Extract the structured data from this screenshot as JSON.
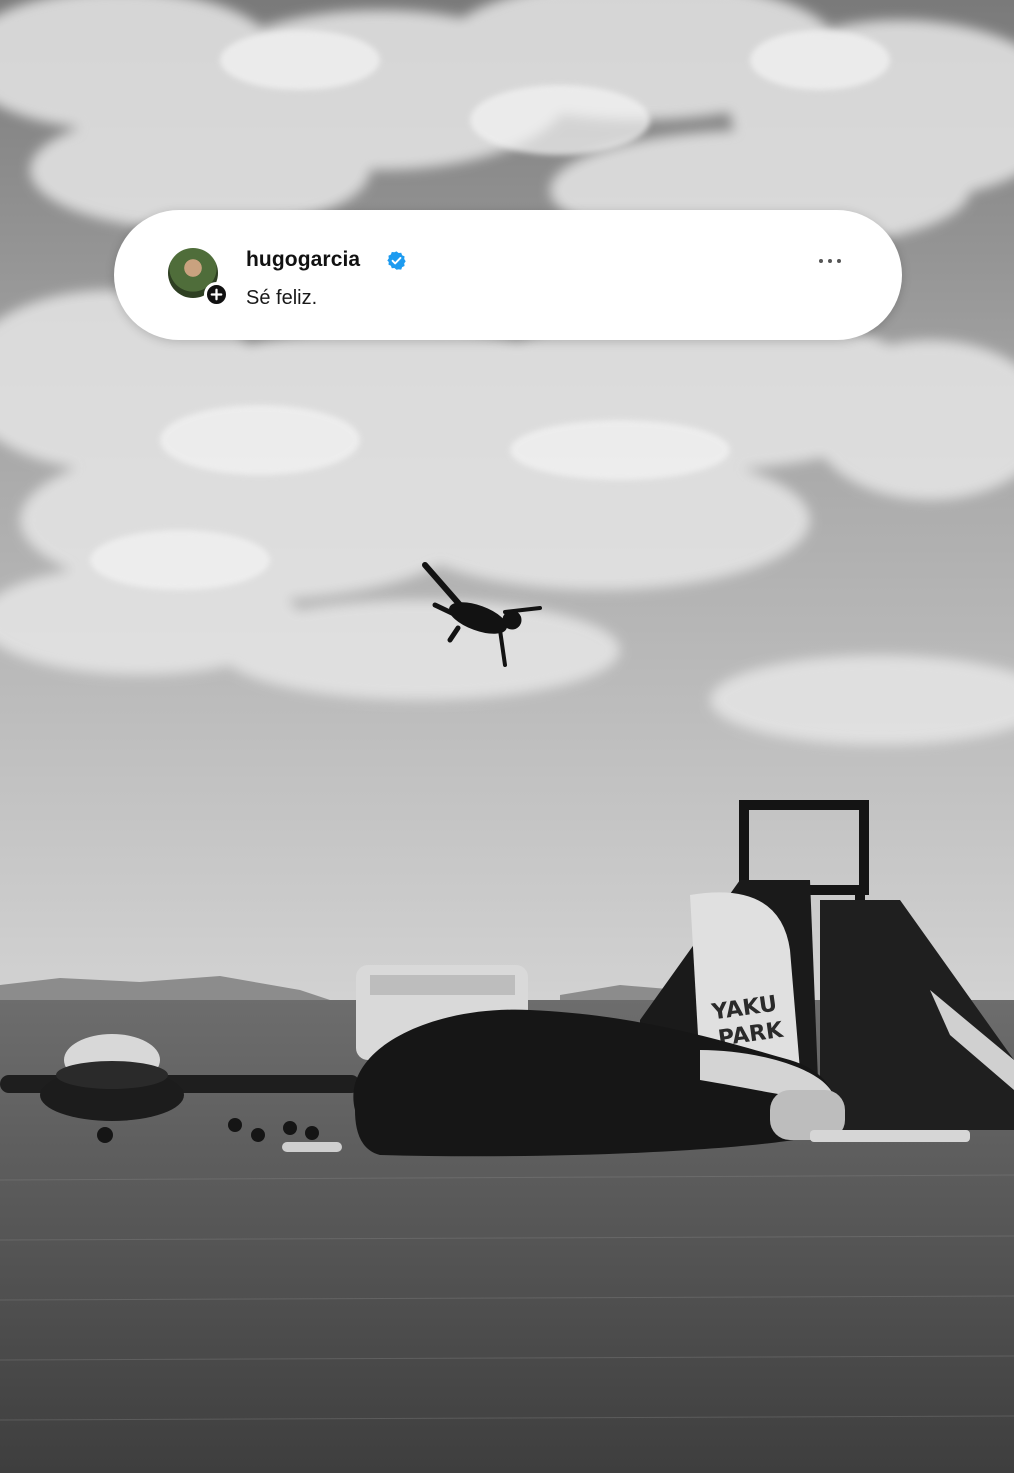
{
  "post": {
    "username": "hugogarcia",
    "caption": "Sé feliz.",
    "verified": true,
    "verified_color": "#1d9bf0"
  },
  "scene": {
    "sign_text": "YAKU PARK",
    "style": "black-and-white"
  },
  "icons": {
    "avatar": "profile-avatar",
    "follow": "plus-icon",
    "verified": "verified-badge-icon",
    "more": "more-horizontal-icon"
  }
}
